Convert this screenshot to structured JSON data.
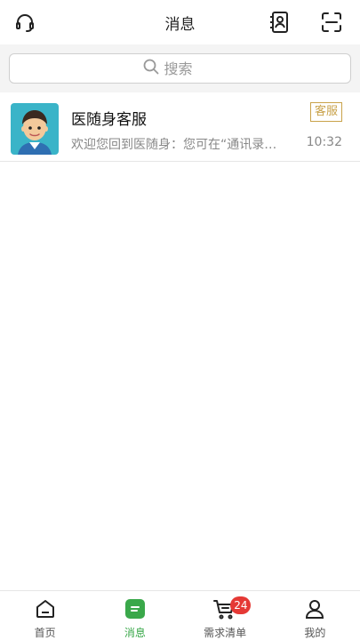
{
  "header": {
    "title": "消息",
    "left_icon": "headset-icon",
    "right_icons": [
      "contacts-icon",
      "scan-icon"
    ]
  },
  "search": {
    "placeholder": "搜索"
  },
  "conversations": [
    {
      "name": "医随身客服",
      "tag": "客服",
      "preview": "欢迎您回到医随身：您可在“通讯录…",
      "time": "10:32",
      "avatar": "customer-service-avatar"
    }
  ],
  "tabbar": {
    "items": [
      {
        "label": "首页",
        "icon": "home-icon",
        "active": false
      },
      {
        "label": "消息",
        "icon": "message-icon",
        "active": true
      },
      {
        "label": "需求清单",
        "icon": "cart-icon",
        "active": false,
        "badge": "24"
      },
      {
        "label": "我的",
        "icon": "profile-icon",
        "active": false
      }
    ]
  },
  "colors": {
    "accent": "#3aa84a",
    "tag": "#c9a24a",
    "badge": "#e53935"
  }
}
